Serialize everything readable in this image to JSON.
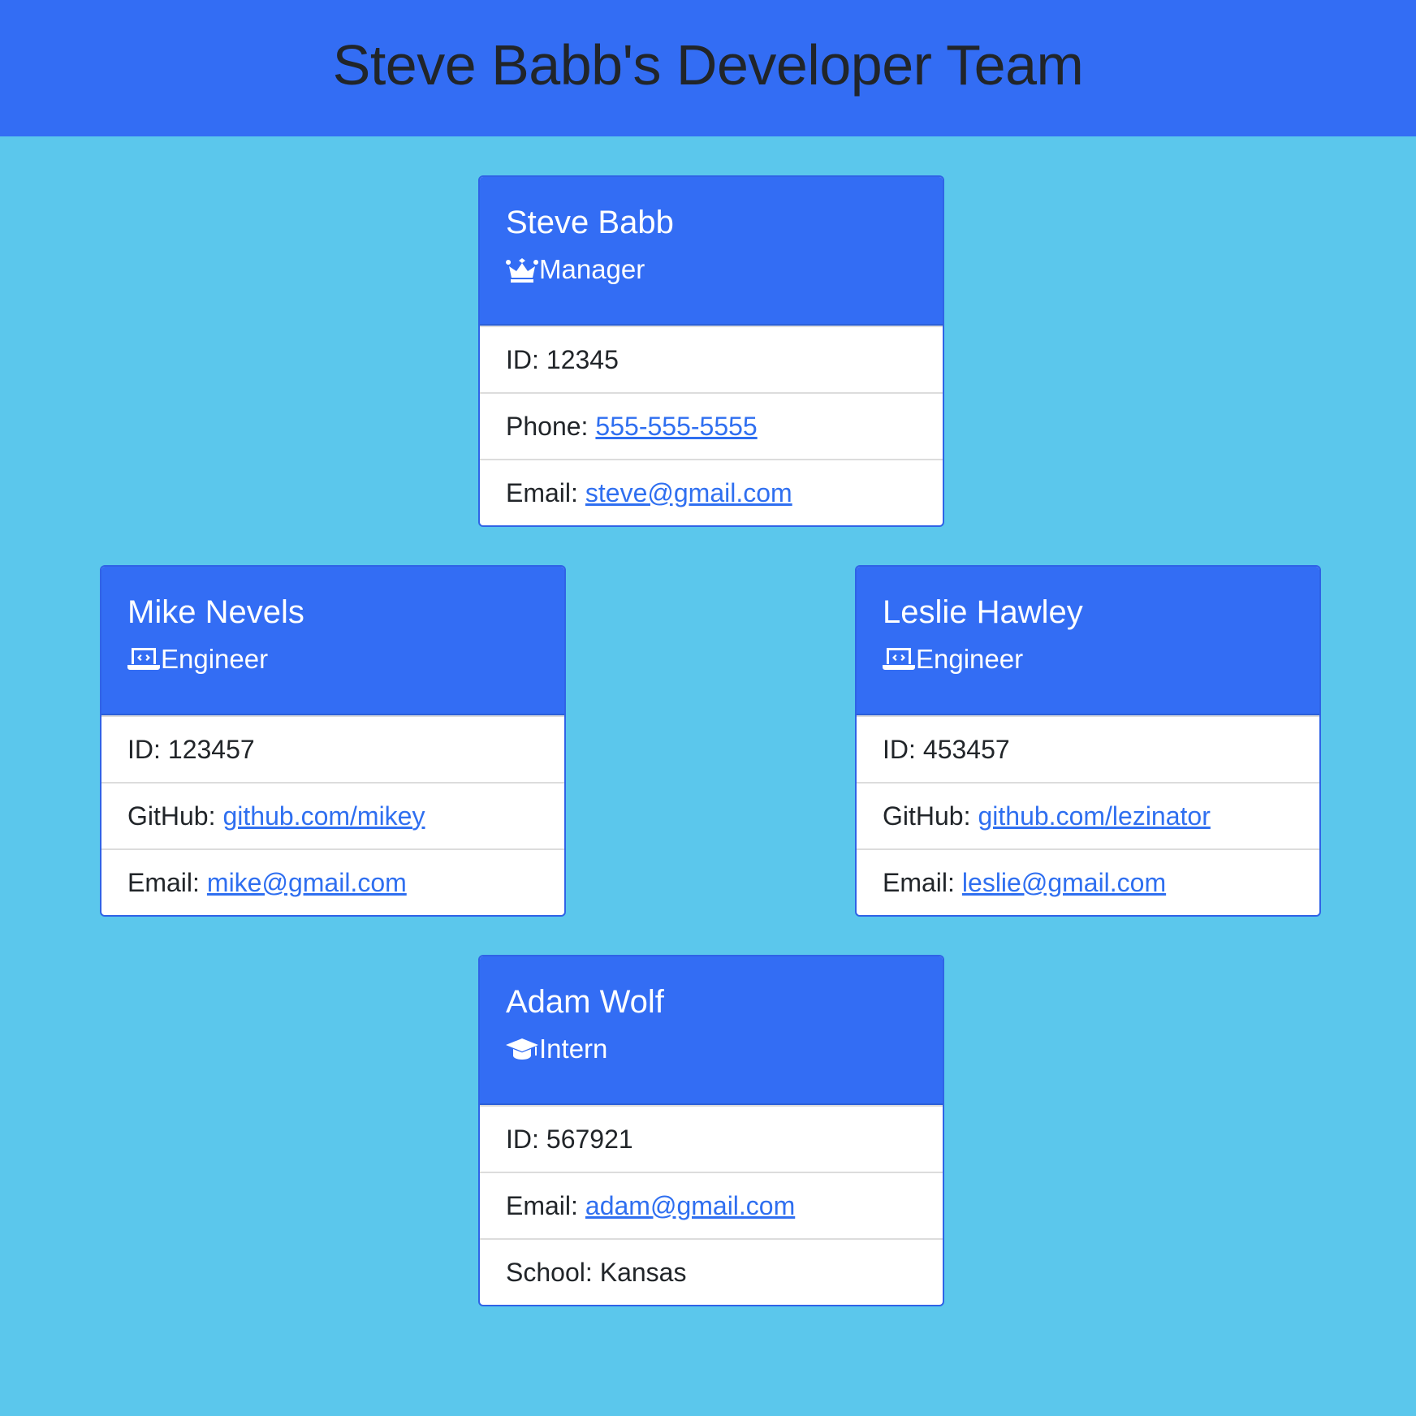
{
  "header": {
    "title": "Steve Babb's Developer Team"
  },
  "colors": {
    "page_background": "#5bc7ec",
    "header_background": "#336df4",
    "link": "#2f6ff0"
  },
  "cards": [
    {
      "name": "Steve Babb",
      "role": "Manager",
      "role_icon": "crown-icon",
      "rows": [
        {
          "label": "ID:",
          "value": "12345"
        },
        {
          "label": "Phone:",
          "value": "555-555-5555"
        },
        {
          "label": "Email:",
          "value": "steve@gmail.com"
        }
      ]
    },
    {
      "name": "Mike Nevels",
      "role": "Engineer",
      "role_icon": "laptop-code-icon",
      "rows": [
        {
          "label": "ID:",
          "value": "123457"
        },
        {
          "label": "GitHub:",
          "value": "github.com/mikey"
        },
        {
          "label": "Email:",
          "value": "mike@gmail.com"
        }
      ]
    },
    {
      "name": "Leslie Hawley",
      "role": "Engineer",
      "role_icon": "laptop-code-icon",
      "rows": [
        {
          "label": "ID:",
          "value": "453457"
        },
        {
          "label": "GitHub:",
          "value": "github.com/lezinator"
        },
        {
          "label": "Email:",
          "value": "leslie@gmail.com"
        }
      ]
    },
    {
      "name": "Adam Wolf",
      "role": "Intern",
      "role_icon": "graduation-cap-icon",
      "rows": [
        {
          "label": "ID:",
          "value": "567921"
        },
        {
          "label": "Email:",
          "value": "adam@gmail.com"
        },
        {
          "label": "School:",
          "value": "Kansas"
        }
      ]
    }
  ]
}
